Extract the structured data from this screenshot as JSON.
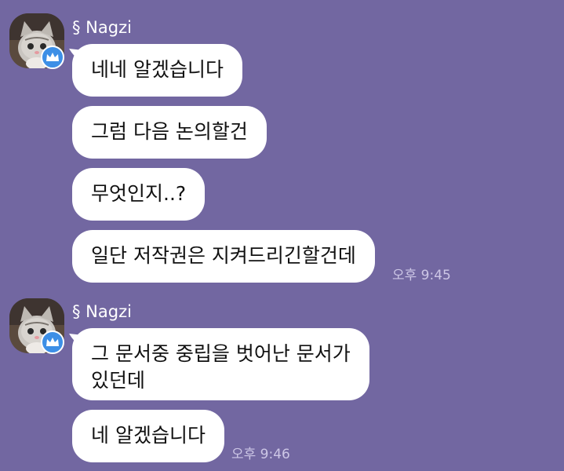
{
  "groups": [
    {
      "sender": "§ Nagzi",
      "avatar_icon": "kitten-avatar-icon",
      "badge_icon": "crown-icon",
      "messages": [
        "네네 알겠습니다",
        "그럼 다음 논의할건",
        "무엇인지..?",
        "일단 저작권은 지켜드리긴할건데"
      ],
      "time": "오후 9:45"
    },
    {
      "sender": "§ Nagzi",
      "avatar_icon": "kitten-avatar-icon",
      "badge_icon": "crown-icon",
      "messages": [
        "그 문서중 중립을 벗어난 문서가\n있던데",
        "네 알겠습니다"
      ],
      "time": "오후 9:46"
    }
  ],
  "colors": {
    "background": "#7267a1",
    "bubble": "#ffffff",
    "badge": "#3d8fe6",
    "timestamp": "#cdc7e6"
  }
}
